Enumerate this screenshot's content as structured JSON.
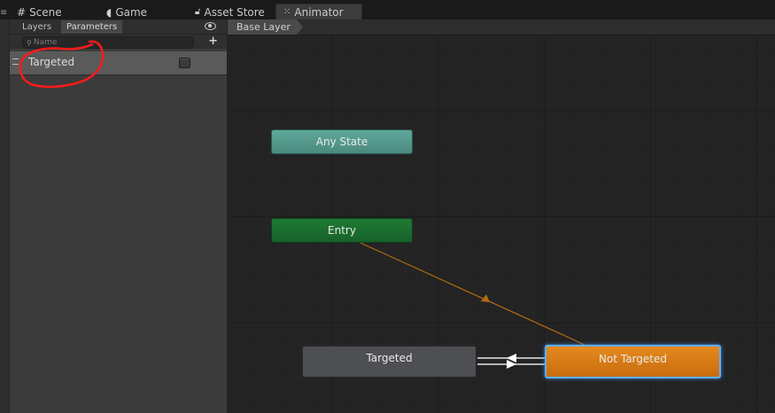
{
  "tabs": [
    {
      "label": "Scene",
      "icon": "grid-icon"
    },
    {
      "label": "Game",
      "icon": "pacman-icon"
    },
    {
      "label": "Asset Store",
      "icon": "lock-icon"
    },
    {
      "label": "Animator",
      "icon": "animator-icon",
      "active": true
    }
  ],
  "panel": {
    "tabs": {
      "layers": "Layers",
      "parameters": "Parameters"
    },
    "search_placeholder": "Name",
    "add_label": "+",
    "parameters": [
      {
        "name": "Targeted",
        "type": "bool",
        "checked": false
      }
    ]
  },
  "breadcrumb": "Base Layer",
  "states": {
    "any": "Any State",
    "entry": "Entry",
    "targeted": "Targeted",
    "not_targeted": "Not Targeted"
  },
  "colors": {
    "any_state": "#5fa89a",
    "entry": "#1f7a33",
    "default_state": "#e5891f",
    "selection": "#5fb0ff",
    "transition_default": "#b36b10",
    "annotation": "#ff1a1a"
  }
}
